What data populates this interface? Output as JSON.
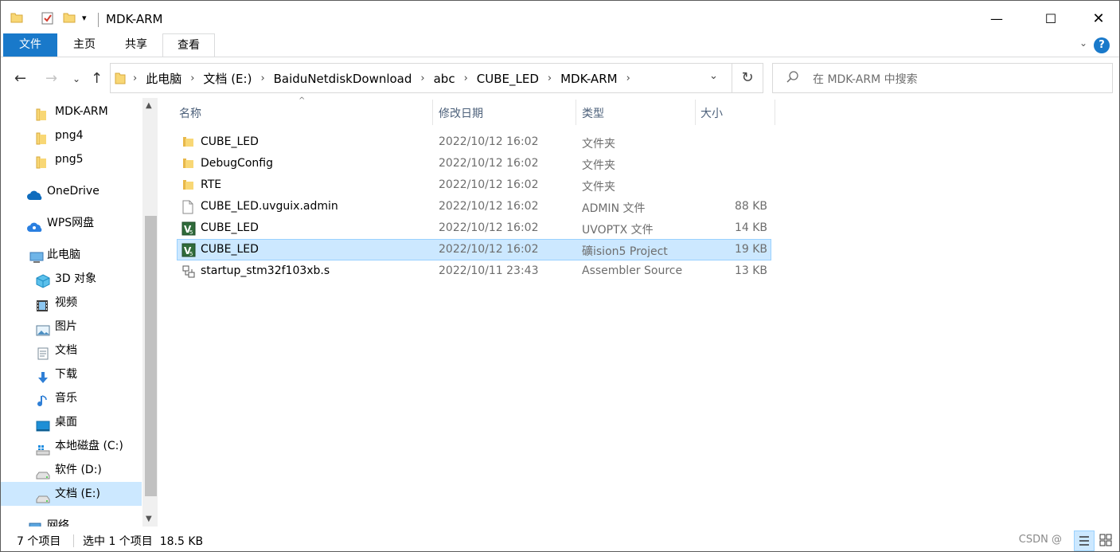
{
  "window": {
    "title": "MDK-ARM"
  },
  "ribbon": {
    "tabs": [
      "文件",
      "主页",
      "共享",
      "查看"
    ],
    "help": "?"
  },
  "address": {
    "crumbs": [
      "此电脑",
      "文档 (E:)",
      "BaiduNetdiskDownload",
      "abc",
      "CUBE_LED",
      "MDK-ARM"
    ]
  },
  "search": {
    "placeholder": "在 MDK-ARM 中搜索"
  },
  "nav": {
    "items": [
      {
        "label": "MDK-ARM",
        "icon": "folder-icon"
      },
      {
        "label": "png4",
        "icon": "folder-icon"
      },
      {
        "label": "png5",
        "icon": "folder-icon"
      },
      {
        "label": "OneDrive",
        "icon": "onedrive-cloud-icon"
      },
      {
        "label": "WPS网盘",
        "icon": "wps-cloud-icon"
      },
      {
        "label": "此电脑",
        "icon": "this-pc-icon"
      },
      {
        "label": "3D 对象",
        "icon": "3d-objects-icon"
      },
      {
        "label": "视频",
        "icon": "videos-icon"
      },
      {
        "label": "图片",
        "icon": "pictures-icon"
      },
      {
        "label": "文档",
        "icon": "documents-icon"
      },
      {
        "label": "下载",
        "icon": "download-arrow-icon"
      },
      {
        "label": "音乐",
        "icon": "music-note-icon"
      },
      {
        "label": "桌面",
        "icon": "desktop-icon"
      },
      {
        "label": "本地磁盘 (C:)",
        "icon": "windows-drive-icon"
      },
      {
        "label": "软件 (D:)",
        "icon": "drive-icon"
      },
      {
        "label": "文档 (E:)",
        "icon": "drive-icon",
        "selected": true
      },
      {
        "label": "网络",
        "icon": "network-icon"
      }
    ]
  },
  "columns": {
    "name": "名称",
    "date": "修改日期",
    "type": "类型",
    "size": "大小"
  },
  "files": [
    {
      "name": "CUBE_LED",
      "date": "2022/10/12 16:02",
      "type": "文件夹",
      "size": "",
      "icon": "folder-icon"
    },
    {
      "name": "DebugConfig",
      "date": "2022/10/12 16:02",
      "type": "文件夹",
      "size": "",
      "icon": "folder-icon"
    },
    {
      "name": "RTE",
      "date": "2022/10/12 16:02",
      "type": "文件夹",
      "size": "",
      "icon": "folder-icon"
    },
    {
      "name": "CUBE_LED.uvguix.admin",
      "date": "2022/10/12 16:02",
      "type": "ADMIN 文件",
      "size": "88 KB",
      "icon": "blank-file-icon"
    },
    {
      "name": "CUBE_LED",
      "date": "2022/10/12 16:02",
      "type": "UVOPTX 文件",
      "size": "14 KB",
      "icon": "keil-uvision-icon"
    },
    {
      "name": "CUBE_LED",
      "date": "2022/10/12 16:02",
      "type": "礦ision5 Project",
      "size": "19 KB",
      "icon": "keil-uvision-icon",
      "selected": true
    },
    {
      "name": "startup_stm32f103xb.s",
      "date": "2022/10/11 23:43",
      "type": "Assembler Source",
      "size": "13 KB",
      "icon": "assembler-file-icon"
    }
  ],
  "status": {
    "count": "7 个项目",
    "selection": "选中 1 个项目  18.5 KB",
    "watermark": "CSDN @"
  },
  "colors": {
    "accent": "#1979ca",
    "selection": "#cce8ff",
    "folder": "#f8d775"
  }
}
